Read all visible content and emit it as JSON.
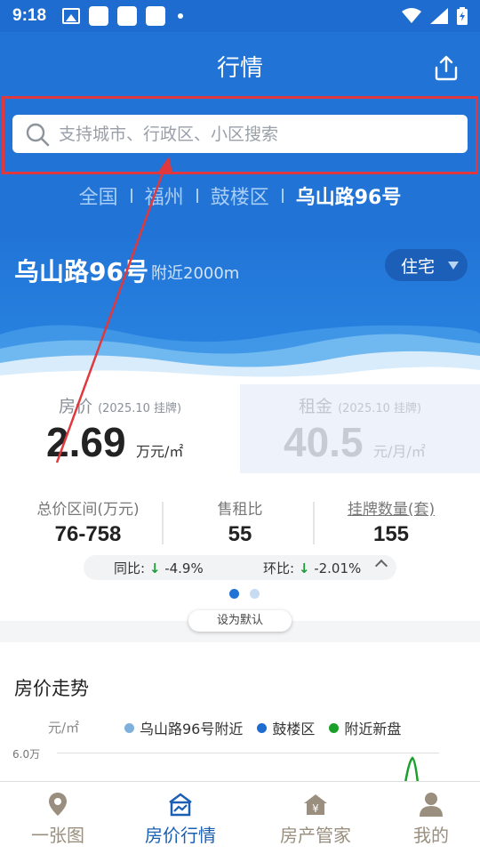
{
  "status_bar": {
    "time": "9:18"
  },
  "header": {
    "title": "行情",
    "search_placeholder": "支持城市、行政区、小区搜索",
    "breadcrumbs": [
      "全国",
      "福州",
      "鼓楼区",
      "乌山路96号"
    ]
  },
  "hero": {
    "location": "乌山路96号",
    "radius": "附近2000m",
    "property_type": "住宅"
  },
  "price_cards": {
    "house": {
      "label": "房价",
      "period": "(2025.10 挂牌)",
      "value": "2.69",
      "unit": "万元/㎡"
    },
    "rent": {
      "label": "租金",
      "period": "(2025.10 挂牌)",
      "value": "40.5",
      "unit": "元/月/㎡"
    }
  },
  "stats": {
    "total_range": {
      "label": "总价区间(万元)",
      "value": "76-758"
    },
    "price_rent_ratio": {
      "label": "售租比",
      "value": "55"
    },
    "listing_count": {
      "label": "挂牌数量(套)",
      "value": "155"
    }
  },
  "changes": {
    "yoy_label": "同比:",
    "yoy_value": "-4.9%",
    "mom_label": "环比:",
    "mom_value": "-2.01%"
  },
  "pager": {
    "pages": 2,
    "current": 1
  },
  "set_default_label": "设为默认",
  "trend": {
    "title": "房价走势",
    "unit": "元/㎡",
    "legend": [
      {
        "label": "乌山路96号附近",
        "color": "#7fb0dd"
      },
      {
        "label": "鼓楼区",
        "color": "#1f6cd0"
      },
      {
        "label": "附近新盘",
        "color": "#1aa02a"
      }
    ],
    "y_tick_top": "6.0万"
  },
  "tabs": [
    {
      "label": "一张图",
      "icon": "map-pin-icon"
    },
    {
      "label": "房价行情",
      "icon": "house-chart-icon",
      "active": true
    },
    {
      "label": "房产管家",
      "icon": "house-manager-icon"
    },
    {
      "label": "我的",
      "icon": "user-icon"
    }
  ],
  "colors": {
    "primary": "#2174d6",
    "highlight": "#e0383e",
    "down": "#1e9a3a",
    "tab_inactive": "#9a8f7e",
    "tab_active": "#1b5fb3"
  }
}
